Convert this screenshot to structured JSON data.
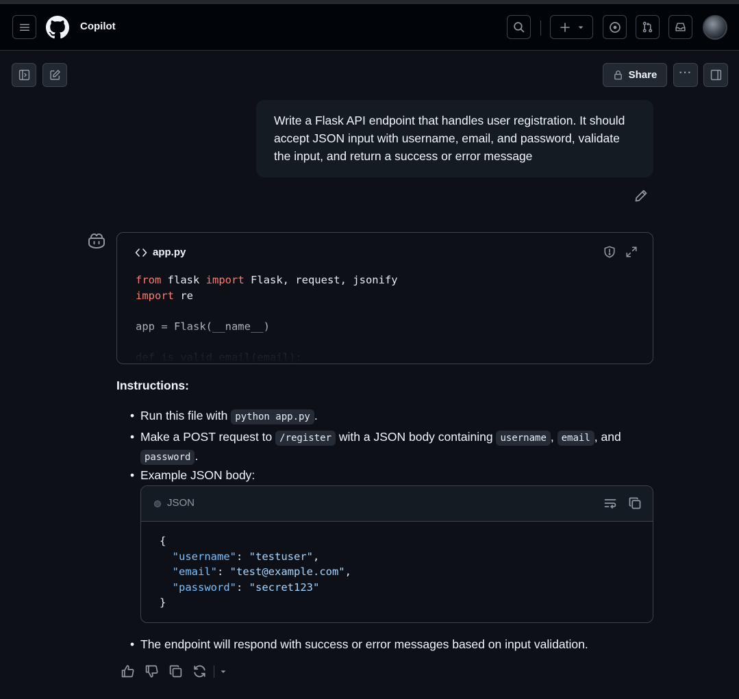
{
  "header": {
    "app_title": "Copilot",
    "icons": [
      "menu-icon",
      "github-logo",
      "search-icon",
      "plus-icon",
      "chevron-down-icon",
      "issues-icon",
      "pull-request-icon",
      "inbox-icon",
      "avatar"
    ]
  },
  "toolbar": {
    "share_label": "Share",
    "more_label": "···"
  },
  "user_message": {
    "text": "Write a Flask API endpoint that handles user registration. It should accept JSON input with username, email, and password, validate the input, and return a success or error message"
  },
  "file_card": {
    "filename": "app.py",
    "code_lines": [
      {
        "parts": [
          {
            "t": "from",
            "k": "kw"
          },
          {
            "t": " flask ",
            "k": ""
          },
          {
            "t": "import",
            "k": "kw"
          },
          {
            "t": " Flask, request, jsonify",
            "k": ""
          }
        ]
      },
      {
        "parts": [
          {
            "t": "import",
            "k": "kw"
          },
          {
            "t": " re",
            "k": ""
          }
        ]
      },
      {
        "parts": [
          {
            "t": "",
            "k": ""
          }
        ]
      },
      {
        "parts": [
          {
            "t": "app = Flask(__name__)",
            "k": ""
          }
        ]
      },
      {
        "parts": [
          {
            "t": "",
            "k": ""
          }
        ]
      },
      {
        "parts": [
          {
            "t": "def is_valid_email(email):",
            "k": ""
          }
        ]
      }
    ]
  },
  "instructions": {
    "title": "Instructions:",
    "b1_pre": "Run this file with ",
    "b1_code": "python app.py",
    "b1_post": ".",
    "b2_pre": "Make a POST request to ",
    "b2_code1": "/register",
    "b2_mid": " with a JSON body containing ",
    "b2_code2": "username",
    "b2_sep1": ",",
    "b2_code3": "email",
    "b2_sep2": ", and",
    "b2_code4": "password",
    "b2_post": ".",
    "b3": "Example JSON body:",
    "b4": "The endpoint will respond with success or error messages based on input validation."
  },
  "json_block": {
    "lang": "JSON",
    "lines": [
      {
        "parts": [
          {
            "t": "{",
            "k": ""
          }
        ]
      },
      {
        "parts": [
          {
            "t": "  ",
            "k": ""
          },
          {
            "t": "\"username\"",
            "k": "jkey"
          },
          {
            "t": ": ",
            "k": ""
          },
          {
            "t": "\"testuser\"",
            "k": "jstr"
          },
          {
            "t": ",",
            "k": ""
          }
        ]
      },
      {
        "parts": [
          {
            "t": "  ",
            "k": ""
          },
          {
            "t": "\"email\"",
            "k": "jkey"
          },
          {
            "t": ": ",
            "k": ""
          },
          {
            "t": "\"test@example.com\"",
            "k": "jstr"
          },
          {
            "t": ",",
            "k": ""
          }
        ]
      },
      {
        "parts": [
          {
            "t": "  ",
            "k": ""
          },
          {
            "t": "\"password\"",
            "k": "jkey"
          },
          {
            "t": ": ",
            "k": ""
          },
          {
            "t": "\"secret123\"",
            "k": "jstr"
          }
        ]
      },
      {
        "parts": [
          {
            "t": "}",
            "k": ""
          }
        ]
      }
    ]
  },
  "colors": {
    "background": "#0d1117",
    "header_bg": "#010409",
    "border": "#3d444d",
    "keyword": "#ff7b72",
    "json_key": "#79c0ff",
    "json_string": "#a5d6ff"
  }
}
